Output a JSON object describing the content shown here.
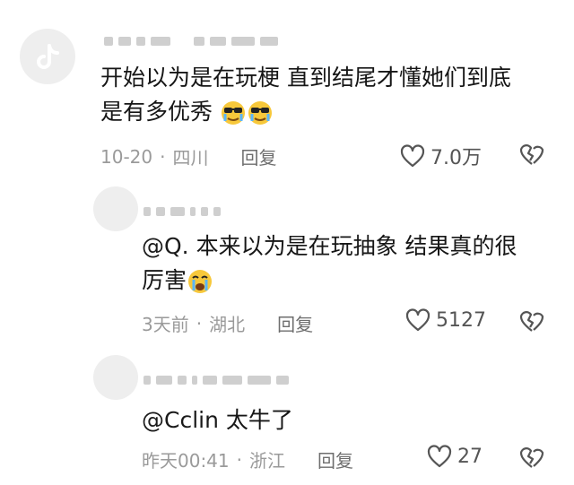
{
  "comments": [
    {
      "text": "开始以为是在玩梗 直到结尾才懂她们到底",
      "text_line2": "是有多优秀",
      "date": "10-20",
      "location": "四川",
      "reply_label": "回复",
      "likes": "7.0万"
    },
    {
      "mention": "@Q.",
      "text": "本来以为是在玩抽象 结果真的很",
      "text_line2": "厉害",
      "date": "3天前",
      "location": "湖北",
      "reply_label": "回复",
      "likes": "5127"
    },
    {
      "mention": "@Cclin",
      "text": "太牛了",
      "date": "昨天00:41",
      "location": "浙江",
      "reply_label": "回复",
      "likes": "27"
    }
  ],
  "separator": "·"
}
